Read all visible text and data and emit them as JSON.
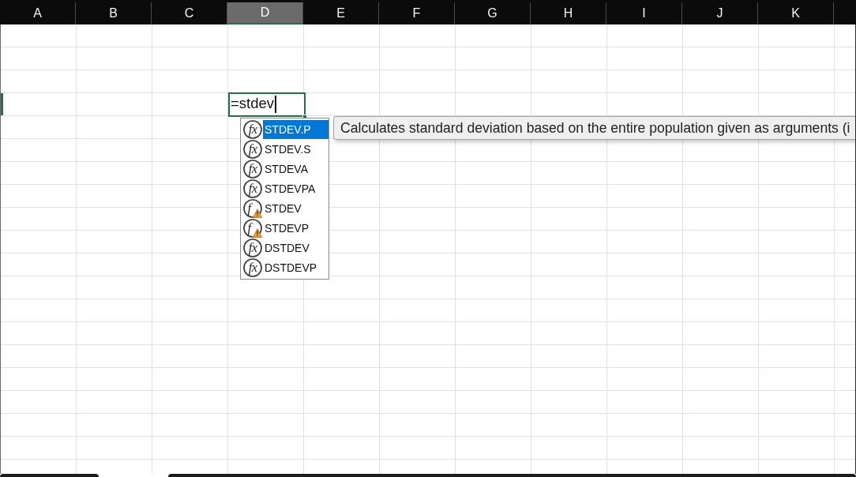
{
  "columns": [
    {
      "label": "A",
      "selected": false
    },
    {
      "label": "B",
      "selected": false
    },
    {
      "label": "C",
      "selected": false
    },
    {
      "label": "D",
      "selected": true
    },
    {
      "label": "E",
      "selected": false
    },
    {
      "label": "F",
      "selected": false
    },
    {
      "label": "G",
      "selected": false
    },
    {
      "label": "H",
      "selected": false
    },
    {
      "label": "I",
      "selected": false
    },
    {
      "label": "J",
      "selected": false
    },
    {
      "label": "K",
      "selected": false
    }
  ],
  "rows": [
    {
      "selected": false
    },
    {
      "selected": false
    },
    {
      "selected": false
    },
    {
      "selected": true
    },
    {
      "selected": false
    },
    {
      "selected": false
    },
    {
      "selected": false
    },
    {
      "selected": false
    },
    {
      "selected": false
    },
    {
      "selected": false
    },
    {
      "selected": false
    },
    {
      "selected": false
    },
    {
      "selected": false
    },
    {
      "selected": false
    },
    {
      "selected": false
    },
    {
      "selected": false
    },
    {
      "selected": false
    },
    {
      "selected": false
    },
    {
      "selected": false
    }
  ],
  "active_cell": {
    "value": "=stdev"
  },
  "autocomplete": {
    "items": [
      {
        "icon": "fx",
        "label": "STDEV.P",
        "warning": false,
        "selected": true
      },
      {
        "icon": "fx",
        "label": "STDEV.S",
        "warning": false,
        "selected": false
      },
      {
        "icon": "fx",
        "label": "STDEVA",
        "warning": false,
        "selected": false
      },
      {
        "icon": "fx",
        "label": "STDEVPA",
        "warning": false,
        "selected": false
      },
      {
        "icon": "f",
        "label": "STDEV",
        "warning": true,
        "selected": false
      },
      {
        "icon": "f",
        "label": "STDEVP",
        "warning": true,
        "selected": false
      },
      {
        "icon": "fx",
        "label": "DSTDEV",
        "warning": false,
        "selected": false
      },
      {
        "icon": "fx",
        "label": "DSTDEVP",
        "warning": false,
        "selected": false
      }
    ]
  },
  "tooltip": {
    "text": "Calculates standard deviation based on the entire population given as arguments (i"
  }
}
